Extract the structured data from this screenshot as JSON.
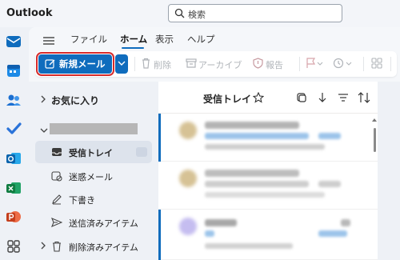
{
  "app": {
    "title": "Outlook"
  },
  "search": {
    "placeholder": "検索"
  },
  "ribbon": {
    "tabs": [
      "ファイル",
      "ホーム",
      "表示",
      "ヘルプ"
    ],
    "active_tab": "ホーム",
    "new_mail_label": "新規メール",
    "delete_label": "削除",
    "archive_label": "アーカイブ",
    "report_label": "報告"
  },
  "folders": {
    "favorites_label": "お気に入り",
    "items": [
      {
        "label": "受信トレイ",
        "icon": "inbox-icon",
        "selected": true
      },
      {
        "label": "迷惑メール",
        "icon": "junk-icon",
        "selected": false
      },
      {
        "label": "下書き",
        "icon": "drafts-icon",
        "selected": false
      },
      {
        "label": "送信済みアイテム",
        "icon": "sent-icon",
        "selected": false
      },
      {
        "label": "削除済みアイテム",
        "icon": "deleted-icon",
        "selected": false
      }
    ]
  },
  "message_list": {
    "title": "受信トレイ"
  },
  "colors": {
    "accent": "#0f6cbd",
    "highlight_border": "#d62b2b",
    "selected_folder_bg": "#dde3ec"
  }
}
